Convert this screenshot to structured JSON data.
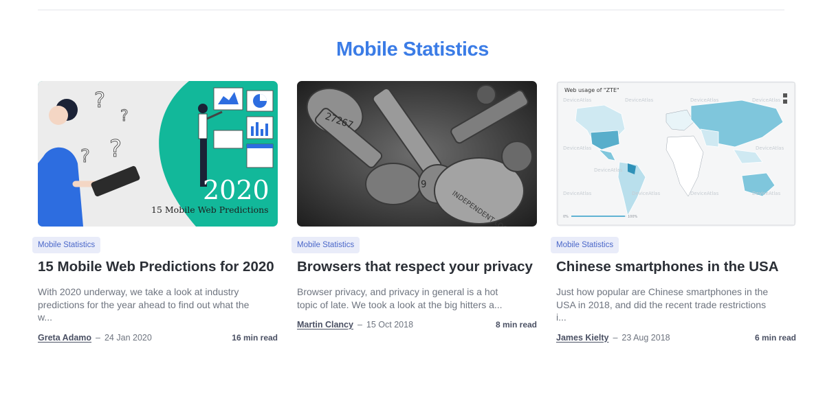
{
  "section": {
    "title": "Mobile Statistics"
  },
  "cards": [
    {
      "tag": "Mobile Statistics",
      "title": "15 Mobile Web Predictions for 2020",
      "excerpt": "With 2020 underway, we take a look at industry predictions for the year ahead to find out what the w...",
      "author": "Greta Adamo",
      "date": "24 Jan 2020",
      "read_time": "16 min read",
      "image": {
        "year": "2020",
        "caption": "15 Mobile Web Predictions"
      }
    },
    {
      "tag": "Mobile Statistics",
      "title": "Browsers that respect your privacy",
      "excerpt": "Browser privacy, and privacy in general is a hot topic of late. We took a look at the big hitters a...",
      "author": "Martin Clancy",
      "date": "15 Oct 2018",
      "read_time": "8 min read",
      "image": {}
    },
    {
      "tag": "Mobile Statistics",
      "title": "Chinese smartphones in the USA",
      "excerpt": "Just how popular are Chinese smartphones in the USA in 2018, and did the recent trade restrictions i...",
      "author": "James Kielty",
      "date": "23 Aug 2018",
      "read_time": "6 min read",
      "image": {
        "map_title": "Web usage of \"ZTE\"",
        "watermark": "DeviceAtlas",
        "scale_min": "0%",
        "scale_max": "100%"
      }
    }
  ],
  "colors": {
    "accent": "#3b7ce6",
    "tag_bg": "#e9ecf9",
    "teal": "#12b89a",
    "map_fill": "#7fc6dc"
  }
}
